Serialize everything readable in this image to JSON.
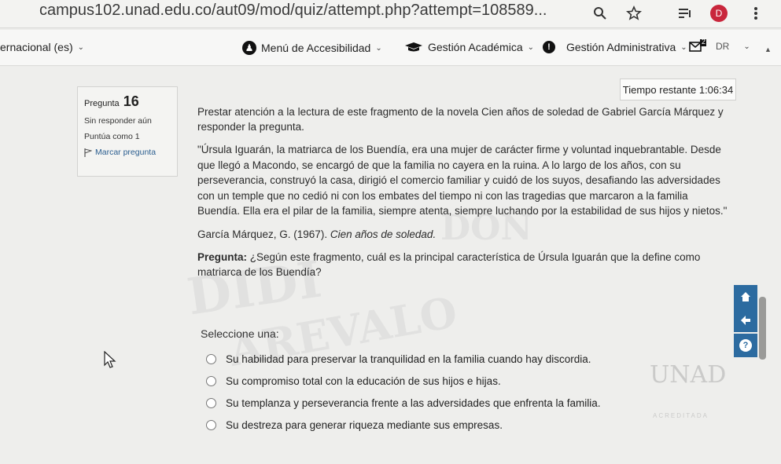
{
  "browser": {
    "url": "campus102.unad.edu.co/aut09/mod/quiz/attempt.php?attempt=108589...",
    "profile_initial": "D",
    "icons": [
      "zoom-icon",
      "star-icon",
      "reading-list-icon",
      "profile-avatar",
      "kebab-menu-icon"
    ]
  },
  "nav": {
    "language": "ernacional (es)",
    "accessibility": "Menú de Accesibilidad",
    "academic": "Gestión Académica",
    "admin": "Gestión Administrativa",
    "message_badge": "2",
    "user_initials": "DR"
  },
  "timer": {
    "label": "Tiempo restante",
    "value": "1:06:34"
  },
  "question_info": {
    "label": "Pregunta",
    "number": "16",
    "status": "Sin responder aún",
    "points": "Puntúa como 1",
    "flag": "Marcar pregunta"
  },
  "question": {
    "intro": "Prestar atención a la lectura de este fragmento de la novela Cien años de soledad de Gabriel García Márquez y responder la pregunta.",
    "quote": "\"Úrsula Iguarán, la matriarca de los Buendía, era una mujer de carácter firme y voluntad inquebrantable. Desde que llegó a Macondo, se encargó de que la familia no cayera en la ruina. A lo largo de los años, con su perseverancia, construyó la casa, dirigió el comercio familiar y cuidó de los suyos, desafiando las adversidades con un temple que no cedió ni con los embates del tiempo ni con las tragedias que marcaron a la familia Buendía. Ella era el pilar de la familia, siempre atenta, siempre luchando por la estabilidad de sus hijos y nietos.\"",
    "ref_author": "García Márquez, G. (1967).",
    "ref_title": "Cien años de soledad.",
    "prompt_label": "Pregunta:",
    "prompt": "¿Según este fragmento, cuál es la principal característica de Úrsula Iguarán que la define como matriarca de los Buendía?",
    "select_label": "Seleccione una:",
    "options": [
      "Su habilidad para preservar la tranquilidad en la familia cuando hay discordia.",
      "Su compromiso total con la educación de sus hijos e hijas.",
      "Su templanza y perseverancia frente a las adversidades que enfrenta la familia.",
      "Su destreza para generar riqueza mediante sus empresas."
    ]
  },
  "watermarks": {
    "logo": "UNAD",
    "accreditation": "ACREDITADA"
  },
  "colors": {
    "accent": "#2c6ba0",
    "avatar": "#c9263c"
  }
}
